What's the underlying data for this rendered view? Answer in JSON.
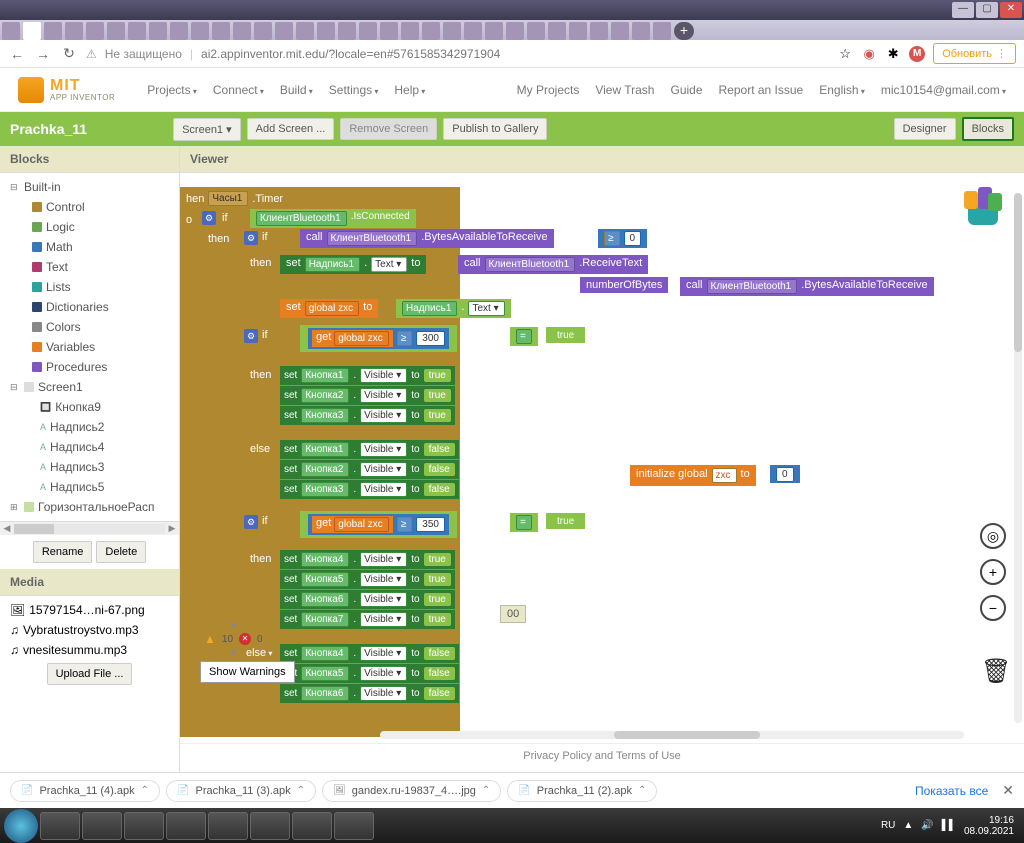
{
  "window": {
    "min": "—",
    "max": "▢",
    "close": "✕"
  },
  "browser": {
    "back": "←",
    "fwd": "→",
    "reload": "↻",
    "secure_text": "Не защищено",
    "url": "ai2.appinventor.mit.edu/?locale=en#5761585342971904",
    "star": "☆",
    "ext": "✦",
    "puzzle": "✱",
    "update": "Обновить",
    "update_ic": "⟳"
  },
  "header": {
    "brand_top": "MIT",
    "brand_bottom": "APP INVENTOR",
    "menu": [
      "Projects",
      "Connect",
      "Build",
      "Settings",
      "Help"
    ],
    "right": {
      "myprojects": "My Projects",
      "trash": "View Trash",
      "guide": "Guide",
      "report": "Report an Issue",
      "lang": "English",
      "email": "mic10154@gmail.com"
    }
  },
  "greenbar": {
    "project": "Prachka_11",
    "screen": "Screen1 ▾",
    "add": "Add Screen ...",
    "remove": "Remove Screen",
    "publish": "Publish to Gallery",
    "designer": "Designer",
    "blocks": "Blocks"
  },
  "blocks_panel": {
    "title": "Blocks",
    "builtin": "Built-in",
    "cats": [
      {
        "label": "Control",
        "color": "#b08830"
      },
      {
        "label": "Logic",
        "color": "#6aa84f"
      },
      {
        "label": "Math",
        "color": "#3878b8"
      },
      {
        "label": "Text",
        "color": "#b03a6e"
      },
      {
        "label": "Lists",
        "color": "#26a69a"
      },
      {
        "label": "Dictionaries",
        "color": "#2b4570"
      },
      {
        "label": "Colors",
        "color": "#888"
      },
      {
        "label": "Variables",
        "color": "#e67e22"
      },
      {
        "label": "Procedures",
        "color": "#7e57c2"
      }
    ],
    "screen": "Screen1",
    "components": [
      "Кнопка9",
      "Надпись2",
      "Надпись4",
      "Надпись3",
      "Надпись5",
      "ГоризонтальноеРасп"
    ],
    "rename": "Rename",
    "delete": "Delete"
  },
  "media": {
    "title": "Media",
    "files": [
      "15797154…ni-67.png",
      "Vybratustroystvo.mp3",
      "vnesitesummu.mp3"
    ],
    "upload": "Upload File ..."
  },
  "viewer": {
    "title": "Viewer",
    "when": "hen",
    "timer_obj": "Часы1",
    "timer_evt": ".Timer",
    "if": "if",
    "then": "then",
    "else": "else",
    "do": "o",
    "bt_client": "КлиентBluetooth1",
    "isconn": ".IsConnected",
    "call": "call",
    "bytes_avail": ".BytesAvailableToReceive",
    "gte": "≥",
    "zero": "0",
    "set": "set",
    "label1": "Надпись1",
    "text_prop": ".Text",
    "to": "to",
    "recv": ".ReceiveText",
    "numbytes": "numberOfBytes",
    "global_zxc": "global zxc",
    "get": "get",
    "eq": "=",
    "true": "true",
    "false": "false",
    "n300": "300",
    "n350": "350",
    "btn1": "Кнопка1",
    "btn2": "Кнопка2",
    "btn3": "Кнопка3",
    "btn4": "Кнопка4",
    "btn5": "Кнопка5",
    "btn6": "Кнопка6",
    "btn7": "Кнопка7",
    "visible": ".Visible",
    "init": "initialize global",
    "zxc": "zxc",
    "init_to": "to",
    "init_val": "0",
    "warn_n": "10",
    "err_n": "0",
    "show_warn": "Show Warnings",
    "val_00": "00"
  },
  "footer": "Privacy Policy and Terms of Use",
  "downloads": {
    "items": [
      "Prachka_11 (4).apk",
      "Prachka_11 (3).apk",
      "gandex.ru-19837_4….jpg",
      "Prachka_11 (2).apk"
    ],
    "show_all": "Показать все"
  },
  "taskbar": {
    "lang": "RU",
    "time": "19:16",
    "date": "08.09.2021"
  }
}
